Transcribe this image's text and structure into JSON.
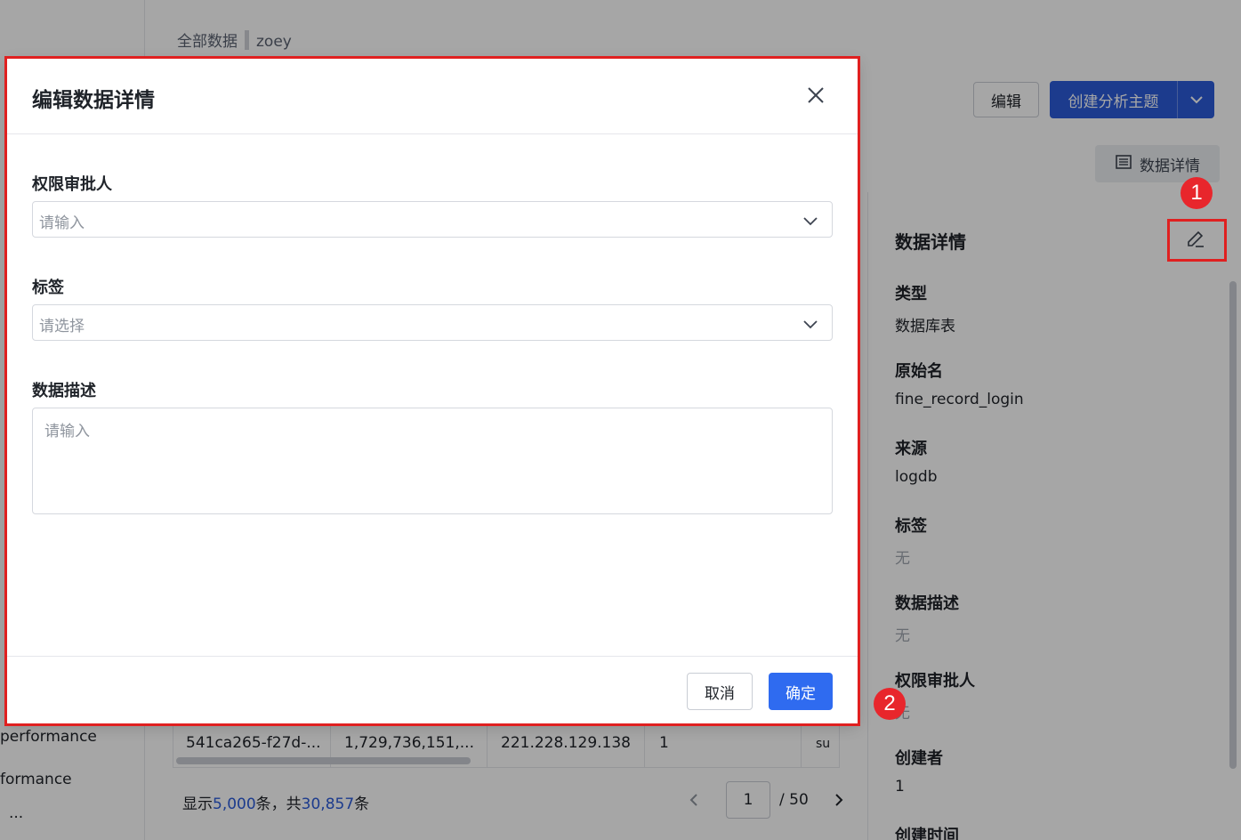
{
  "breadcrumb": {
    "root": "全部数据",
    "current": "zoey"
  },
  "left_nav": {
    "items": [
      "performance",
      "formance",
      "..."
    ]
  },
  "toolbar": {
    "edit_label": "编辑",
    "create_label": "创建分析主题",
    "detail_label": "数据详情"
  },
  "detail_panel": {
    "title": "数据详情",
    "fields": [
      {
        "label": "类型",
        "value": "数据库表"
      },
      {
        "label": "原始名",
        "value": "fine_record_login"
      },
      {
        "label": "来源",
        "value": "logdb"
      },
      {
        "label": "标签",
        "value": "无"
      },
      {
        "label": "数据描述",
        "value": "无"
      },
      {
        "label": "权限审批人",
        "value": "无"
      },
      {
        "label": "创建者",
        "value": "1"
      },
      {
        "label": "创建时间",
        "value": ""
      }
    ]
  },
  "table": {
    "row": [
      "541ca265-f27d-...",
      "1,729,736,151,...",
      "221.228.129.138",
      "1",
      "su"
    ]
  },
  "footer": {
    "shown_prefix": "显示",
    "shown_count": "5,000",
    "shown_mid": "条，共",
    "total_count": "30,857",
    "shown_suffix": "条",
    "page_current": "1",
    "page_total": "/ 50"
  },
  "modal": {
    "title": "编辑数据详情",
    "approver_label": "权限审批人",
    "approver_placeholder": "请输入",
    "tags_label": "标签",
    "tags_placeholder": "请选择",
    "desc_label": "数据描述",
    "desc_placeholder": "请输入",
    "cancel_label": "取消",
    "ok_label": "确定"
  },
  "annotations": {
    "badge1": "1",
    "badge2": "2"
  },
  "colors": {
    "primary": "#2b5bd9",
    "annotation": "#e02020"
  }
}
